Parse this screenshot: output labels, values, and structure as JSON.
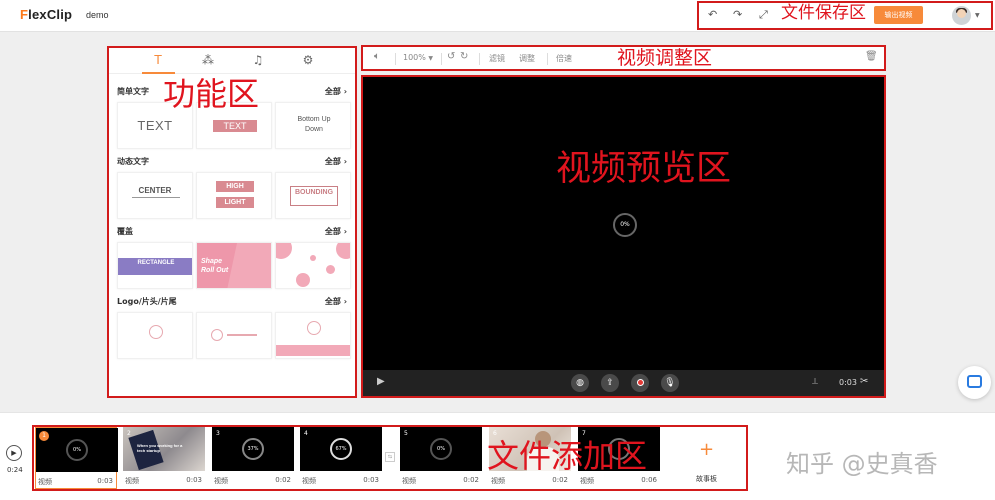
{
  "app": {
    "logo": "FlexClip",
    "project_name": "demo"
  },
  "header": {
    "undo_icon": "undo-icon",
    "redo_icon": "redo-icon",
    "fullscreen_icon": "fullscreen-icon",
    "export_label": "输出视频",
    "avatar_icon": "user-avatar"
  },
  "annotations": {
    "save_zone": "文件保存区",
    "func_zone": "功能区",
    "adjust_zone": "视频调整区",
    "preview_zone": "视频预览区",
    "add_zone": "文件添加区"
  },
  "left_panel": {
    "tabs": [
      {
        "icon": "text-icon",
        "glyph": "T"
      },
      {
        "icon": "elements-icon",
        "glyph": "⁂"
      },
      {
        "icon": "music-icon",
        "glyph": "♫"
      },
      {
        "icon": "settings-icon",
        "glyph": "⚙"
      }
    ],
    "sections": [
      {
        "title": "简单文字",
        "all": "全部",
        "cards": [
          "TEXT",
          "TEXT",
          "Bottom Up Down"
        ]
      },
      {
        "title": "动态文字",
        "all": "全部",
        "cards": [
          "CENTER",
          "HIGH",
          "LIGHT",
          "BOUNDING"
        ]
      },
      {
        "title": "覆盖",
        "all": "全部",
        "cards": [
          "RECTANGLE",
          "Shape Roll Out"
        ]
      },
      {
        "title": "Logo/片头/片尾",
        "all": "全部",
        "cards": []
      }
    ],
    "chevron_icon": "chevron-right-icon"
  },
  "video_toolbar": {
    "volume_icon": "volume-icon",
    "zoom": "100%",
    "rotate_left_icon": "rotate-left-icon",
    "rotate_right_icon": "rotate-right-icon",
    "filter": "滤镜",
    "adjust": "调整",
    "speed": "倍速",
    "delete_icon": "trash-icon"
  },
  "preview": {
    "progress": "0%",
    "play_icon": "play-icon",
    "globe_icon": "globe-icon",
    "upload_icon": "upload-icon",
    "record_icon": "record-icon",
    "mic_icon": "mic-icon",
    "cut_icon": "cut-icon",
    "time": "0:03",
    "scissors_icon": "scissors-icon"
  },
  "timeline": {
    "total_time": "0:24",
    "clips": [
      {
        "num": "1",
        "progress": "0%",
        "label": "视频",
        "duration": "0:03",
        "type": "dark"
      },
      {
        "num": "2",
        "progress": "",
        "label": "视频",
        "duration": "0:03",
        "type": "photo",
        "overlay": "When you working for a tech startup"
      },
      {
        "num": "3",
        "progress": "37%",
        "label": "视频",
        "duration": "0:02",
        "type": "dark"
      },
      {
        "num": "4",
        "progress": "67%",
        "label": "视频",
        "duration": "0:03",
        "type": "dark"
      },
      {
        "num": "5",
        "progress": "0%",
        "label": "视频",
        "duration": "0:02",
        "type": "dark"
      },
      {
        "num": "6",
        "progress": "",
        "label": "视频",
        "duration": "0:02",
        "type": "light"
      },
      {
        "num": "7",
        "progress": "",
        "label": "视频",
        "duration": "0:06",
        "type": "dark"
      }
    ],
    "storyboard": "故事板",
    "plus": "+"
  },
  "watermark": "知乎 @史真香",
  "colors": {
    "accent": "#f78a3a",
    "annotation": "#e0141e",
    "pink": "#d98a91",
    "purple": "#8a7cc4"
  }
}
